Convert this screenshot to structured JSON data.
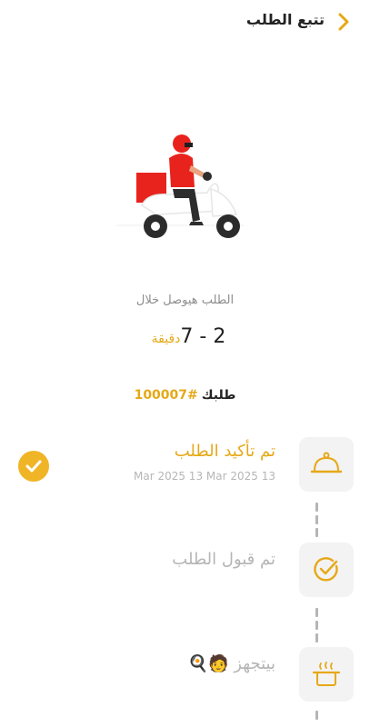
{
  "header": {
    "title": "تتبع الطلب"
  },
  "delivery": {
    "arrival_label": "الطلب هيوصل خلال",
    "eta_value": "2 - 7",
    "eta_unit": "دقيقة"
  },
  "order": {
    "label": "طلبك",
    "number": "#100007"
  },
  "steps": [
    {
      "title": "تم تأكيد الطلب",
      "date": "13 Mar 2025 13 Mar 2025",
      "status": "done",
      "icon": "cloche-icon"
    },
    {
      "title": "تم قبول الطلب",
      "status": "pending",
      "icon": "check-circle-icon"
    },
    {
      "title": "بيتجهز 🧑🍳",
      "status": "pending",
      "icon": "cooking-pot-icon"
    }
  ],
  "colors": {
    "accent": "#e6a817",
    "badge": "#f0b526",
    "inactive_text": "#b5b5b5",
    "step_box": "#f3f3f3"
  }
}
